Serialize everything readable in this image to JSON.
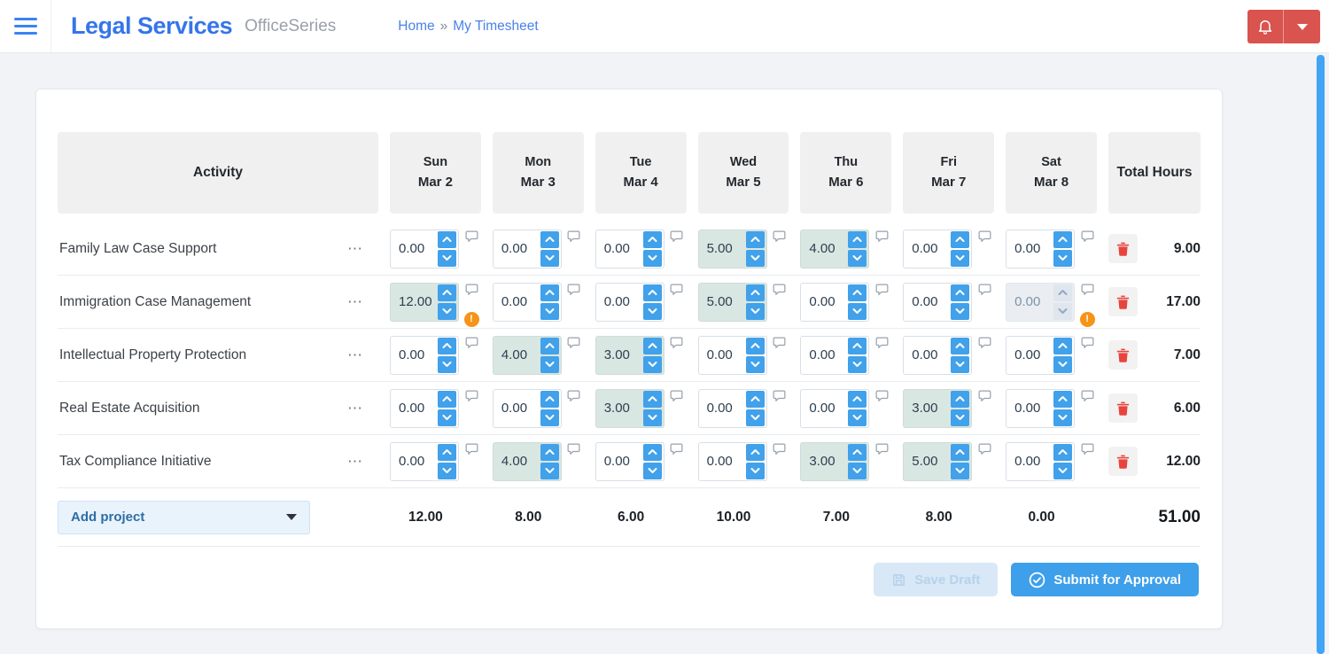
{
  "header": {
    "brand": "Legal Services",
    "suite": "OfficeSeries",
    "breadcrumb": {
      "home": "Home",
      "separator": "»",
      "current": "My Timesheet"
    }
  },
  "icons": {
    "row_menu": "⋯",
    "warning": "!"
  },
  "colors": {
    "accent_blue": "#41a1ea",
    "brand_blue": "#3575e9",
    "alert_red": "#d9534f",
    "filled_cell": "#d9e7e2",
    "warning_orange": "#f59417",
    "trash_red": "#e8443c"
  },
  "table": {
    "activity_header": "Activity",
    "total_header": "Total Hours",
    "days": [
      {
        "name": "Sun",
        "date": "Mar 2"
      },
      {
        "name": "Mon",
        "date": "Mar 3"
      },
      {
        "name": "Tue",
        "date": "Mar 4"
      },
      {
        "name": "Wed",
        "date": "Mar 5"
      },
      {
        "name": "Thu",
        "date": "Mar 6"
      },
      {
        "name": "Fri",
        "date": "Mar 7"
      },
      {
        "name": "Sat",
        "date": "Mar 8"
      }
    ],
    "rows": [
      {
        "activity": "Family Law Case Support",
        "total": "9.00",
        "cells": [
          {
            "value": "0.00",
            "filled": false,
            "disabled": false,
            "warning": false
          },
          {
            "value": "0.00",
            "filled": false,
            "disabled": false,
            "warning": false
          },
          {
            "value": "0.00",
            "filled": false,
            "disabled": false,
            "warning": false
          },
          {
            "value": "5.00",
            "filled": true,
            "disabled": false,
            "warning": false
          },
          {
            "value": "4.00",
            "filled": true,
            "disabled": false,
            "warning": false
          },
          {
            "value": "0.00",
            "filled": false,
            "disabled": false,
            "warning": false
          },
          {
            "value": "0.00",
            "filled": false,
            "disabled": false,
            "warning": false
          }
        ]
      },
      {
        "activity": "Immigration Case Management",
        "total": "17.00",
        "cells": [
          {
            "value": "12.00",
            "filled": true,
            "disabled": false,
            "warning": true
          },
          {
            "value": "0.00",
            "filled": false,
            "disabled": false,
            "warning": false
          },
          {
            "value": "0.00",
            "filled": false,
            "disabled": false,
            "warning": false
          },
          {
            "value": "5.00",
            "filled": true,
            "disabled": false,
            "warning": false
          },
          {
            "value": "0.00",
            "filled": false,
            "disabled": false,
            "warning": false
          },
          {
            "value": "0.00",
            "filled": false,
            "disabled": false,
            "warning": false
          },
          {
            "value": "0.00",
            "filled": false,
            "disabled": true,
            "warning": true
          }
        ]
      },
      {
        "activity": "Intellectual Property Protection",
        "total": "7.00",
        "cells": [
          {
            "value": "0.00",
            "filled": false,
            "disabled": false,
            "warning": false
          },
          {
            "value": "4.00",
            "filled": true,
            "disabled": false,
            "warning": false
          },
          {
            "value": "3.00",
            "filled": true,
            "disabled": false,
            "warning": false
          },
          {
            "value": "0.00",
            "filled": false,
            "disabled": false,
            "warning": false
          },
          {
            "value": "0.00",
            "filled": false,
            "disabled": false,
            "warning": false
          },
          {
            "value": "0.00",
            "filled": false,
            "disabled": false,
            "warning": false
          },
          {
            "value": "0.00",
            "filled": false,
            "disabled": false,
            "warning": false
          }
        ]
      },
      {
        "activity": "Real Estate Acquisition",
        "total": "6.00",
        "cells": [
          {
            "value": "0.00",
            "filled": false,
            "disabled": false,
            "warning": false
          },
          {
            "value": "0.00",
            "filled": false,
            "disabled": false,
            "warning": false
          },
          {
            "value": "3.00",
            "filled": true,
            "disabled": false,
            "warning": false
          },
          {
            "value": "0.00",
            "filled": false,
            "disabled": false,
            "warning": false
          },
          {
            "value": "0.00",
            "filled": false,
            "disabled": false,
            "warning": false
          },
          {
            "value": "3.00",
            "filled": true,
            "disabled": false,
            "warning": false
          },
          {
            "value": "0.00",
            "filled": false,
            "disabled": false,
            "warning": false
          }
        ]
      },
      {
        "activity": "Tax Compliance Initiative",
        "total": "12.00",
        "cells": [
          {
            "value": "0.00",
            "filled": false,
            "disabled": false,
            "warning": false
          },
          {
            "value": "4.00",
            "filled": true,
            "disabled": false,
            "warning": false
          },
          {
            "value": "0.00",
            "filled": false,
            "disabled": false,
            "warning": false
          },
          {
            "value": "0.00",
            "filled": false,
            "disabled": false,
            "warning": false
          },
          {
            "value": "3.00",
            "filled": true,
            "disabled": false,
            "warning": false
          },
          {
            "value": "5.00",
            "filled": true,
            "disabled": false,
            "warning": false
          },
          {
            "value": "0.00",
            "filled": false,
            "disabled": false,
            "warning": false
          }
        ]
      }
    ],
    "footer": {
      "add_project_label": "Add project",
      "day_totals": [
        "12.00",
        "8.00",
        "6.00",
        "10.00",
        "7.00",
        "8.00",
        "0.00"
      ],
      "grand_total": "51.00"
    }
  },
  "actions": {
    "save_draft_label": "Save Draft",
    "submit_label": "Submit for Approval"
  }
}
